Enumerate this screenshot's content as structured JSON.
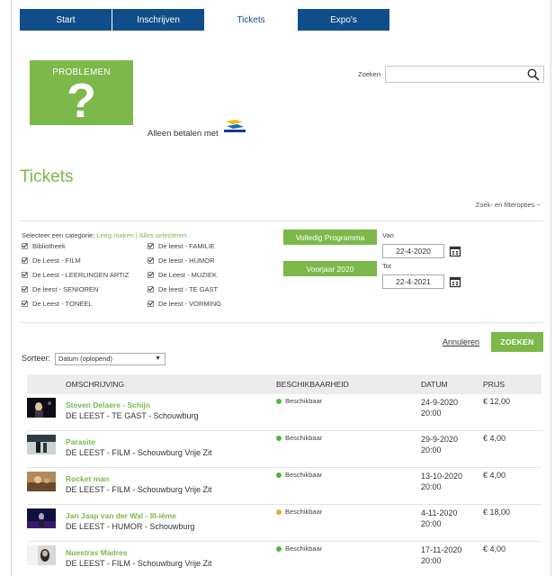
{
  "nav": {
    "tabs": [
      {
        "label": "Start",
        "active": false
      },
      {
        "label": "Inschrijven",
        "active": false
      },
      {
        "label": "Tickets",
        "active": true
      },
      {
        "label": "Expo's",
        "active": false
      }
    ]
  },
  "banner": {
    "text": "PROBLEMEN",
    "symbol": "?"
  },
  "payment": {
    "text": "Alleen betalen met",
    "logo_text": "Bancontact"
  },
  "search": {
    "label": "Zoeken",
    "value": "",
    "placeholder": ""
  },
  "page_title": "Tickets",
  "filter_options": "Zoek- en filteropties −",
  "categories": {
    "label": "Selecteer een categorie:",
    "clear": "Leeg maken",
    "separator": "|",
    "select_all": "Alles selecteren",
    "left": [
      "Bibliotheek",
      "De Leest - FILM",
      "De Leest - LEERLINGEN ARTIZ",
      "De leest - SENIOREN",
      "De Leest - TONEEL"
    ],
    "right": [
      "De leest - FAMILIE",
      "De leest - HUMOR",
      "De Leest - MUZIEK",
      "De leest - TE GAST",
      "De leest - VORMING"
    ]
  },
  "buttons": {
    "full_program": "Volledig Programma",
    "spring": "Voorjaar 2020",
    "cancel": "Annuleren",
    "search": "ZOEKEN"
  },
  "dates": {
    "from_label": "Van",
    "from_value": "22-4-2020",
    "to_label": "Tot",
    "to_value": "22-4-2021"
  },
  "sort": {
    "label": "Sorteer:",
    "value": "Datum (oplopend)"
  },
  "table": {
    "headers": [
      "OMSCHRIJVING",
      "BESCHIKBAARHEID",
      "DATUM",
      "PRIJS"
    ],
    "rows": [
      {
        "title": "Steven Delaere - Schijn",
        "venue": "DE LEEST - TE GAST - Schouwburg",
        "availability": "Beschikbaar",
        "status_color": "#4cbb3c",
        "date": "24-9-2020",
        "time": "20:00",
        "price": "€ 12,00"
      },
      {
        "title": "Parasite",
        "venue": "DE LEEST - FILM - Schouwburg Vrije Zit",
        "availability": "Beschikbaar",
        "status_color": "#4cbb3c",
        "date": "29-9-2020",
        "time": "20:00",
        "price": "€ 4,00"
      },
      {
        "title": "Rocket man",
        "venue": "DE LEEST - FILM - Schouwburg Vrije Zit",
        "availability": "Beschikbaar",
        "status_color": "#4cbb3c",
        "date": "13-10-2020",
        "time": "20:00",
        "price": "€ 4,00"
      },
      {
        "title": "Jan Jaap van der Wal - III-ième",
        "venue": "DE LEEST - HUMOR - Schouwburg",
        "availability": "Beschikbaar",
        "status_color": "#f0a830",
        "date": "4-11-2020",
        "time": "20:00",
        "price": "€ 18,00"
      },
      {
        "title": "Nuestras Madres",
        "venue": "DE LEEST - FILM - Schouwburg Vrije Zit",
        "availability": "Beschikbaar",
        "status_color": "#4cbb3c",
        "date": "17-11-2020",
        "time": "20:00",
        "price": "€ 4,00"
      }
    ]
  },
  "colors": {
    "nav": "#0f4e8a",
    "accent": "#7cb84a",
    "available": "#4cbb3c",
    "limited": "#f0a830"
  }
}
